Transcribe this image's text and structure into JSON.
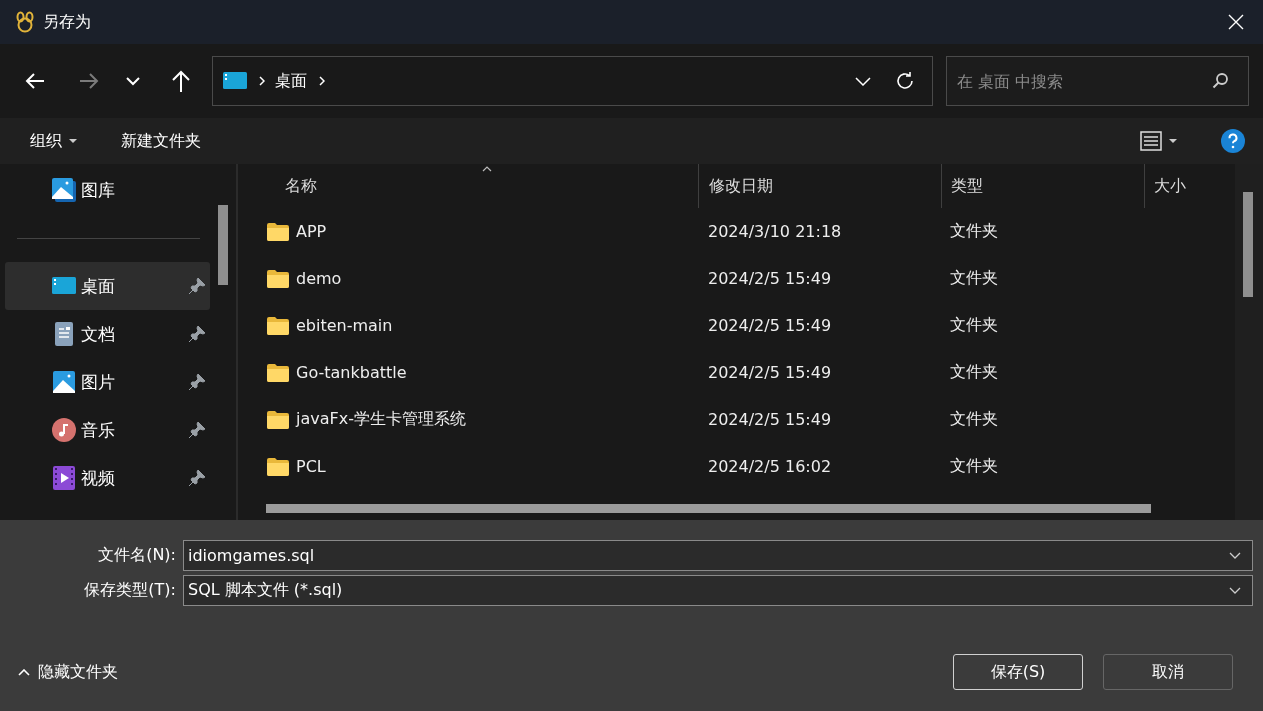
{
  "window": {
    "title": "另存为"
  },
  "nav": {
    "back_disabled": false,
    "forward_disabled": true,
    "breadcrumb": [
      "桌面"
    ],
    "search": {
      "placeholder": "在 桌面 中搜索"
    }
  },
  "toolbar": {
    "organize": "组织",
    "new_folder": "新建文件夹"
  },
  "sidebar": {
    "items": [
      {
        "kind": "gallery",
        "label": "图库",
        "pinned": false,
        "selected": false
      },
      {
        "kind": "divider"
      },
      {
        "kind": "desktop",
        "label": "桌面",
        "pinned": true,
        "selected": true
      },
      {
        "kind": "documents",
        "label": "文档",
        "pinned": true,
        "selected": false
      },
      {
        "kind": "pictures",
        "label": "图片",
        "pinned": true,
        "selected": false
      },
      {
        "kind": "music",
        "label": "音乐",
        "pinned": true,
        "selected": false
      },
      {
        "kind": "videos",
        "label": "视频",
        "pinned": true,
        "selected": false
      }
    ]
  },
  "table": {
    "columns": [
      {
        "label": "名称",
        "sorted": true
      },
      {
        "label": "修改日期",
        "sorted": false
      },
      {
        "label": "类型",
        "sorted": false
      },
      {
        "label": "大小",
        "sorted": false
      }
    ],
    "rows": [
      {
        "name": "APP",
        "modified": "2024/3/10 21:18",
        "type": "文件夹",
        "selected": false
      },
      {
        "name": "demo",
        "modified": "2024/2/5 15:49",
        "type": "文件夹",
        "selected": false
      },
      {
        "name": "ebiten-main",
        "modified": "2024/2/5 15:49",
        "type": "文件夹",
        "selected": false
      },
      {
        "name": "Go-tankbattle",
        "modified": "2024/2/5 15:49",
        "type": "文件夹",
        "selected": false
      },
      {
        "name": "javaFx-学生卡管理系统",
        "modified": "2024/2/5 15:49",
        "type": "文件夹",
        "selected": false
      },
      {
        "name": "PCL",
        "modified": "2024/2/5 16:02",
        "type": "文件夹",
        "selected": false
      }
    ]
  },
  "fields": [
    {
      "label": "文件名(N):",
      "value": "idiomgames.sql"
    },
    {
      "label": "保存类型(T):",
      "value": "SQL 脚本文件 (*.sql)"
    }
  ],
  "footer": {
    "toggle": "隐藏文件夹",
    "buttons": [
      {
        "label": "保存(S)",
        "default": true
      },
      {
        "label": "取消",
        "default": false
      }
    ]
  }
}
